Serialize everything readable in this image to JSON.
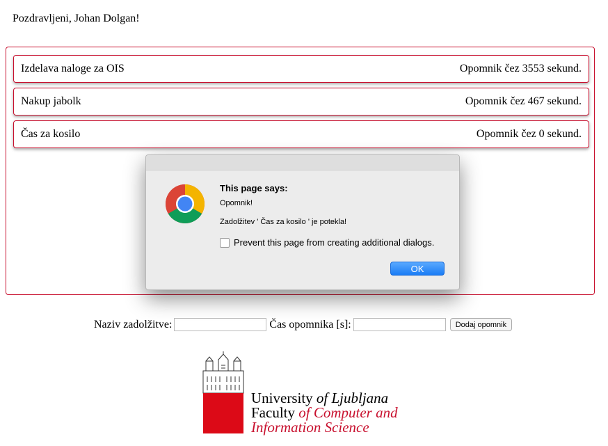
{
  "greeting": "Pozdravljeni, Johan Dolgan!",
  "tasks": [
    {
      "name": "Izdelava naloge za OIS",
      "reminder": "Opomnik čez 3553 sekund."
    },
    {
      "name": "Nakup jabolk",
      "reminder": "Opomnik čez 467 sekund."
    },
    {
      "name": "Čas za kosilo",
      "reminder": "Opomnik čez 0 sekund."
    }
  ],
  "form": {
    "name_label": "Naziv zadolžitve:",
    "name_value": "",
    "time_label": "Čas opomnika [s]:",
    "time_value": "",
    "add_button": "Dodaj opomnik"
  },
  "dialog": {
    "title": "This page says:",
    "message1": "Opomnik!",
    "message2": "Zadolžitev ' Čas za kosilo ' je potekla!",
    "checkbox_label": "Prevent this page from creating additional dialogs.",
    "checkbox_checked": false,
    "ok_button": "OK"
  },
  "logo": {
    "line1_a": "University ",
    "line1_b": "of Ljubljana",
    "line2_a": "Faculty ",
    "line2_b": "of Computer and",
    "line3": "Information Science"
  },
  "colors": {
    "accent": "#c8102e",
    "ok_button": "#1a7cf5"
  }
}
